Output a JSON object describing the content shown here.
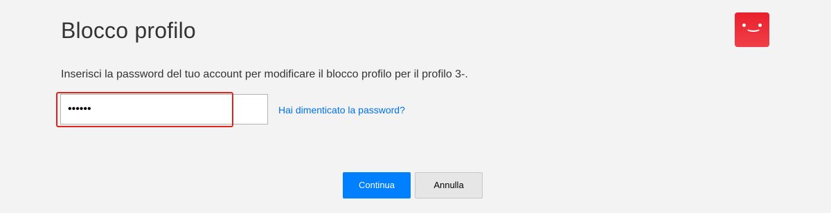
{
  "header": {
    "title": "Blocco profilo",
    "avatar_icon": "smiley-profile-icon",
    "avatar_color": "#e50914"
  },
  "form": {
    "instruction": "Inserisci la password del tuo account per modificare il blocco profilo per il profilo 3-.",
    "password_value": "••••••",
    "forgot_link": "Hai dimenticato la password?"
  },
  "actions": {
    "continue_label": "Continua",
    "cancel_label": "Annulla"
  },
  "colors": {
    "accent": "#0080ff",
    "link": "#0071eb",
    "error_highlight": "#e2231a"
  }
}
